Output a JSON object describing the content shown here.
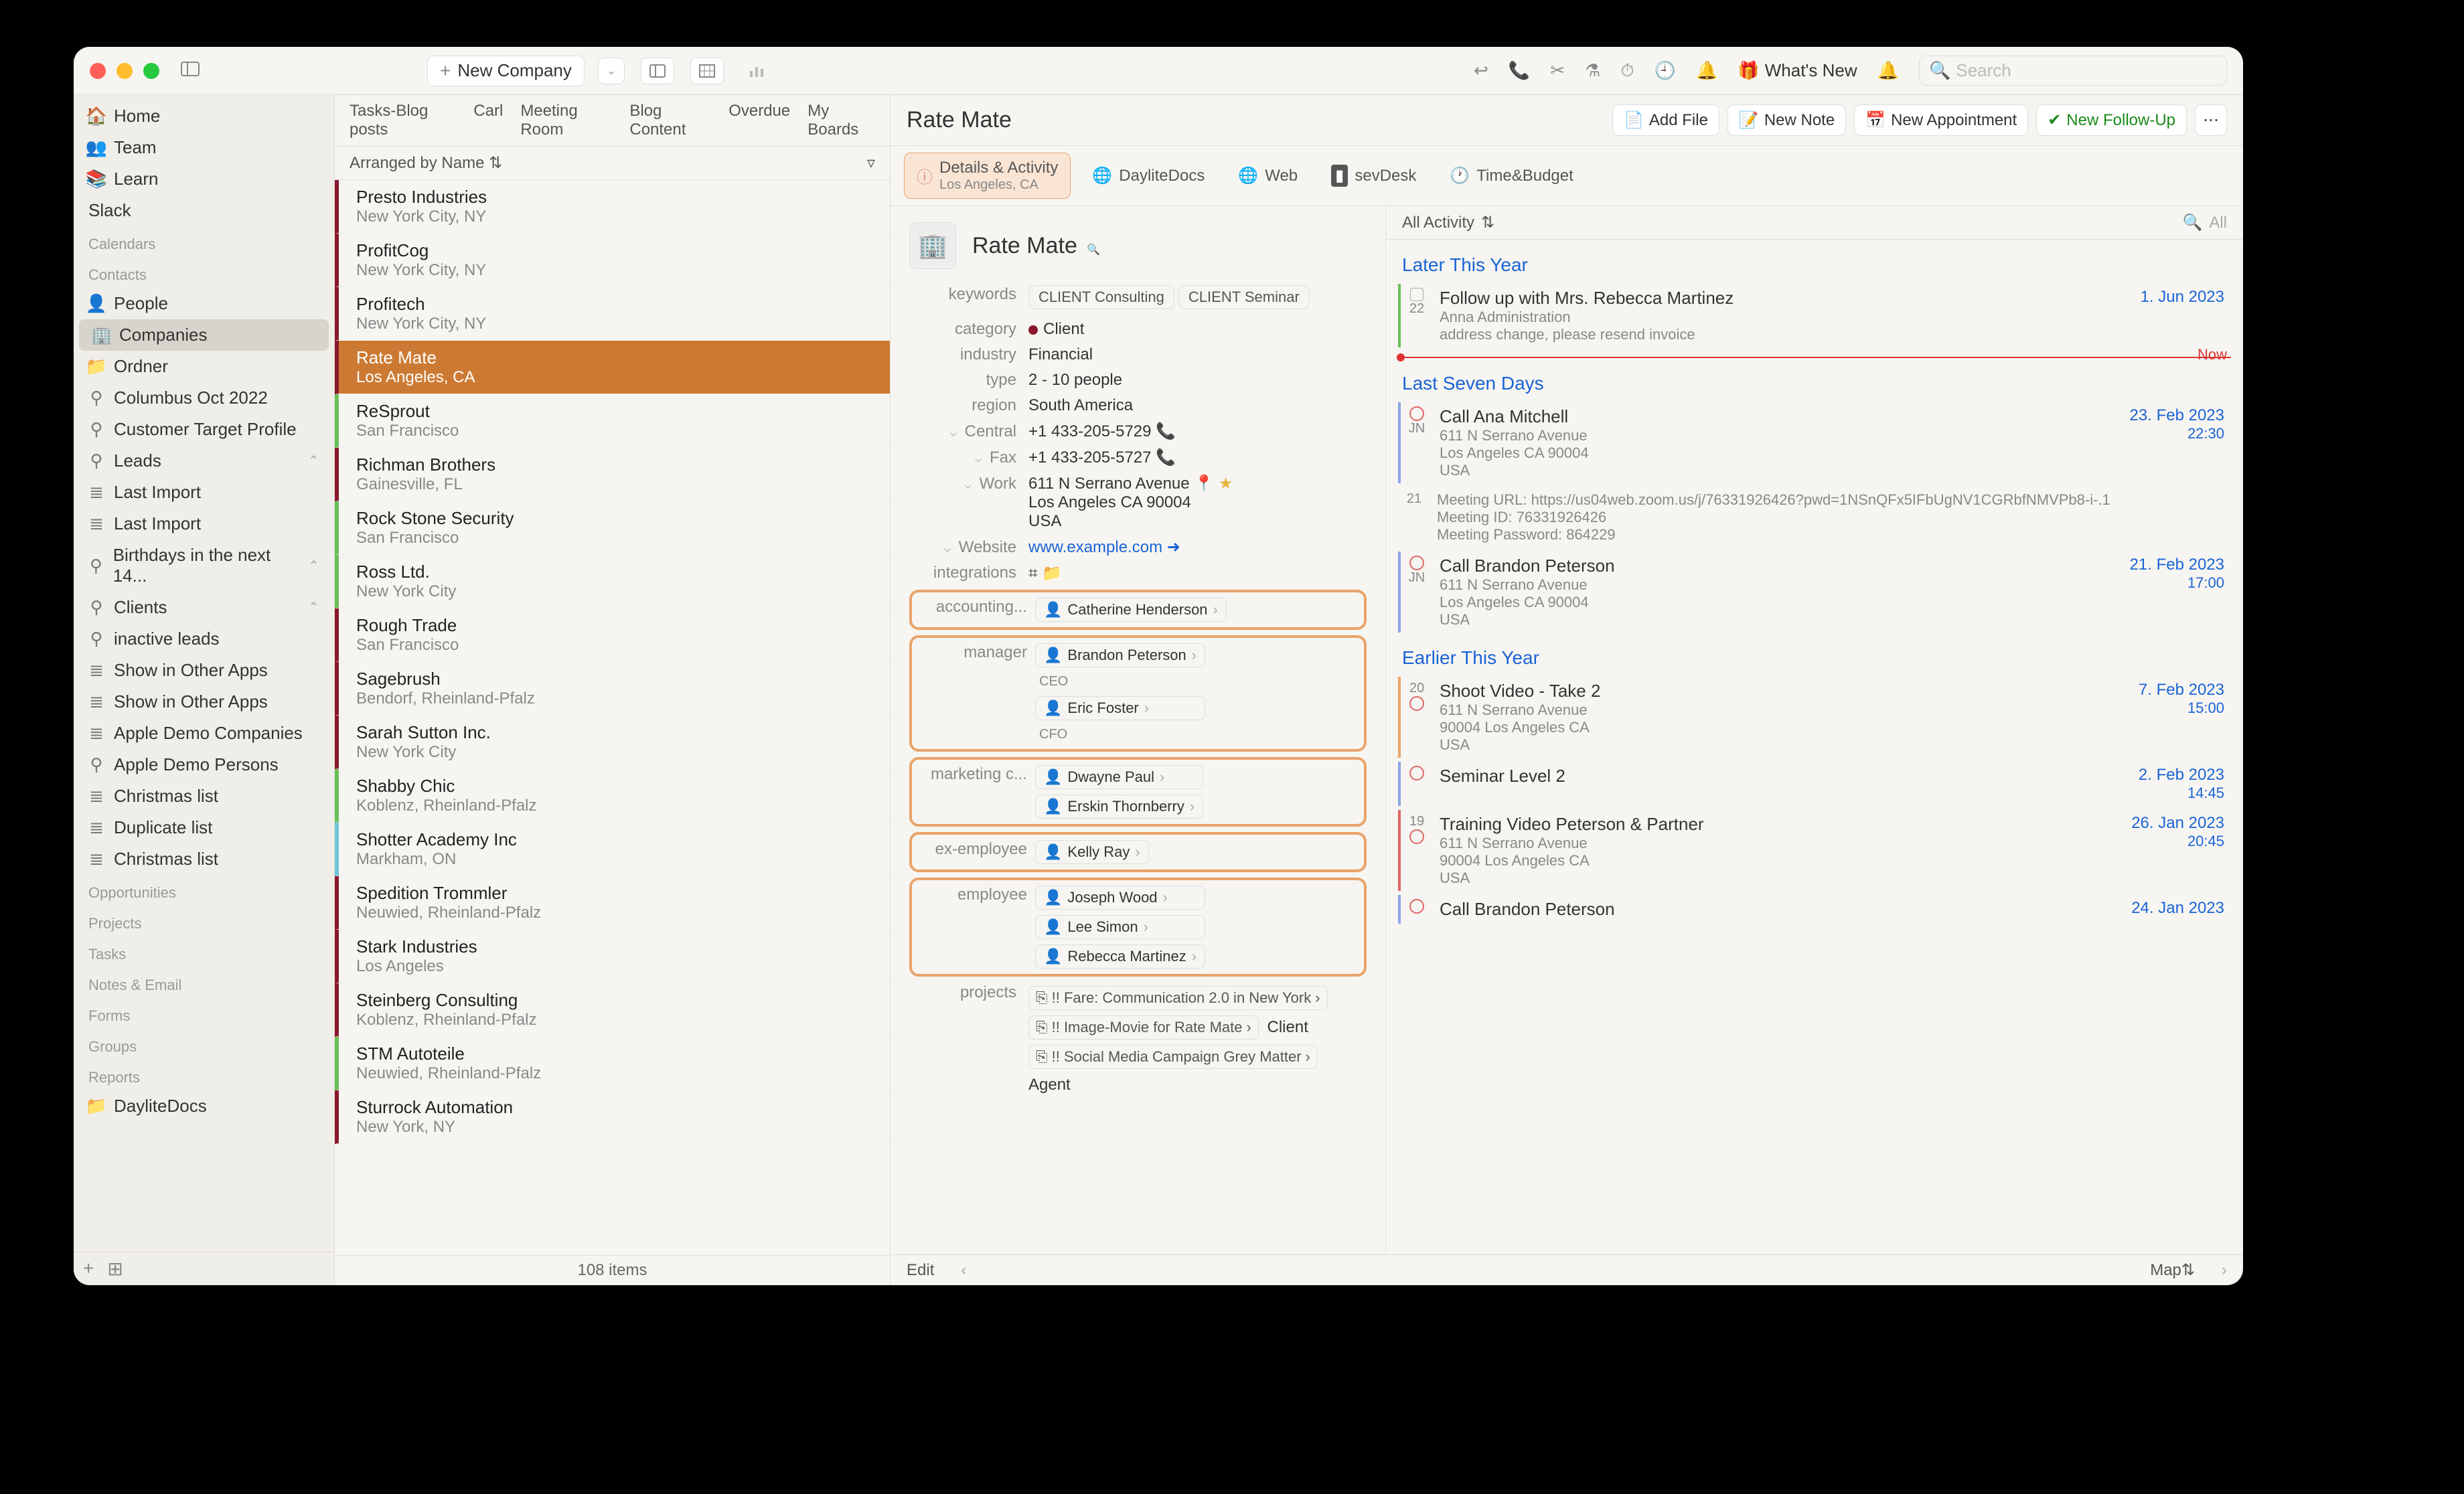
{
  "toolbar": {
    "new_company": "New Company",
    "whats_new": "What's New",
    "search_placeholder": "Search"
  },
  "sidebar": {
    "home": "Home",
    "team": "Team",
    "learn": "Learn",
    "slack": "Slack",
    "calendars_head": "Calendars",
    "contacts_head": "Contacts",
    "people": "People",
    "companies": "Companies",
    "ordner": "Ordner",
    "columbus": "Columbus Oct 2022",
    "ctp": "Customer Target Profile",
    "leads": "Leads",
    "lastimport1": "Last Import",
    "lastimport2": "Last Import",
    "birthdays": "Birthdays in the next 14...",
    "clients": "Clients",
    "inactive": "inactive leads",
    "showother1": "Show in Other Apps",
    "showother2": "Show in Other Apps",
    "applecomp": "Apple Demo Companies",
    "applepers": "Apple Demo Persons",
    "xmas1": "Christmas list",
    "dup": "Duplicate list",
    "xmas2": "Christmas list",
    "opportunities_head": "Opportunities",
    "projects_head": "Projects",
    "tasks_head": "Tasks",
    "notes_head": "Notes & Email",
    "forms_head": "Forms",
    "groups_head": "Groups",
    "reports_head": "Reports",
    "daylitedocs": "DayliteDocs"
  },
  "tabs": [
    "Tasks-Blog posts",
    "Carl",
    "Meeting Room",
    "Blog Content",
    "Overdue",
    "My Boards"
  ],
  "arranged": "Arranged by Name",
  "companies": [
    {
      "t": "Presto Industries",
      "s": "New York City, NY",
      "c": "#8a182e"
    },
    {
      "t": "ProfitCog",
      "s": "New York City, NY",
      "c": "#8a182e"
    },
    {
      "t": "Profitech",
      "s": "New York City, NY",
      "c": "#8a182e"
    },
    {
      "t": "Rate Mate",
      "s": "Los Angeles, CA",
      "c": "#8a182e",
      "sel": true
    },
    {
      "t": "ReSprout",
      "s": "San Francisco",
      "c": "#6bbf59"
    },
    {
      "t": "Richman Brothers",
      "s": "Gainesville, FL",
      "c": "#8a182e"
    },
    {
      "t": "Rock Stone Security",
      "s": "San Francisco",
      "c": "#6bbf59"
    },
    {
      "t": "Ross Ltd.",
      "s": "New York City",
      "c": "#6bbf59"
    },
    {
      "t": "Rough Trade",
      "s": "San Francisco",
      "c": "#8a182e"
    },
    {
      "t": "Sagebrush",
      "s": "Bendorf, Rheinland-Pfalz",
      "c": "#8a182e"
    },
    {
      "t": "Sarah Sutton Inc.",
      "s": "New York City",
      "c": "#8a182e"
    },
    {
      "t": "Shabby Chic",
      "s": "Koblenz, Rheinland-Pfalz",
      "c": "#6bbf59"
    },
    {
      "t": "Shotter Academy Inc",
      "s": "Markham, ON",
      "c": "#6ec6d9"
    },
    {
      "t": "Spedition Trommler",
      "s": "Neuwied, Rheinland-Pfalz",
      "c": "#8a182e"
    },
    {
      "t": "Stark Industries",
      "s": "Los Angeles",
      "c": "#8a182e"
    },
    {
      "t": "Steinberg Consulting",
      "s": "Koblenz, Rheinland-Pfalz",
      "c": "#8a182e"
    },
    {
      "t": "STM Autoteile",
      "s": "Neuwied, Rheinland-Pfalz",
      "c": "#6bbf59"
    },
    {
      "t": "Sturrock Automation",
      "s": "New York, NY",
      "c": "#8a182e"
    }
  ],
  "itemcount": "108 items",
  "detail": {
    "title": "Rate Mate",
    "add_file": "Add File",
    "new_note": "New Note",
    "new_appt": "New Appointment",
    "new_follow": "New Follow-Up",
    "tabs": {
      "details": "Details & Activity",
      "details_sub": "Los Angeles, CA",
      "docs": "DayliteDocs",
      "web": "Web",
      "sevdesk": "sevDesk",
      "timebudget": "Time&Budget"
    },
    "company_name": "Rate Mate",
    "keywords_k": "keywords",
    "kw1": "CLIENT Consulting",
    "kw2": "CLIENT Seminar",
    "category_k": "category",
    "category_v": "Client",
    "industry_k": "industry",
    "industry_v": "Financial",
    "type_k": "type",
    "type_v": "2 - 10 people",
    "region_k": "region",
    "region_v": "South America",
    "central_k": "Central",
    "central_v": "+1 433-205-5729",
    "fax_k": "Fax",
    "fax_v": "+1 433-205-5727",
    "work_k": "Work",
    "addr1": "611 N Serrano Avenue",
    "addr2": "Los Angeles  CA  90004",
    "addr3": "USA",
    "website_k": "Website",
    "website_v": "www.example.com",
    "integrations_k": "integrations",
    "roles": [
      {
        "label": "accounting...",
        "people": [
          {
            "n": "Catherine Henderson"
          }
        ]
      },
      {
        "label": "manager",
        "people": [
          {
            "n": "Brandon Peterson",
            "sub": "CEO"
          },
          {
            "n": "Eric Foster",
            "sub": "CFO"
          }
        ]
      },
      {
        "label": "marketing c...",
        "people": [
          {
            "n": "Dwayne Paul"
          },
          {
            "n": "Erskin Thornberry"
          }
        ]
      },
      {
        "label": "ex-employee",
        "people": [
          {
            "n": "Kelly Ray"
          }
        ]
      },
      {
        "label": "employee",
        "people": [
          {
            "n": "Joseph Wood"
          },
          {
            "n": "Lee Simon"
          },
          {
            "n": "Rebecca Martinez"
          }
        ]
      }
    ],
    "projects_k": "projects",
    "projects": [
      "!! Fare: Communication 2.0 in New York",
      "!! Image-Movie for Rate Mate",
      "!! Social Media Campaign Grey Matter"
    ],
    "projrole1": "Client",
    "projrole2": "Agent",
    "edit": "Edit"
  },
  "activity": {
    "filter": "All Activity",
    "all": "All",
    "sec1": "Later This Year",
    "i1": {
      "t": "Follow up with Mrs. Rebecca Martinez",
      "s1": "Anna Administration",
      "s2": "address change, please resend invoice",
      "d": "1. Jun 2023"
    },
    "sec2": "Last Seven Days",
    "i2": {
      "t": "Call Ana Mitchell",
      "s1": "611 N Serrano Avenue",
      "s2": "Los Angeles CA 90004",
      "s3": "USA",
      "d": "23. Feb 2023",
      "tm": "22:30"
    },
    "i2b": {
      "l1": "Meeting URL: https://us04web.zoom.us/j/76331926426?pwd=1NSnQFx5IFbUgNV1CGRbfNMVPb8-i-.1",
      "l2": "Meeting ID: 76331926426",
      "l3": "Meeting Password: 864229"
    },
    "i3": {
      "t": "Call Brandon Peterson",
      "s1": "611 N Serrano Avenue",
      "s2": "Los Angeles CA 90004",
      "s3": "USA",
      "d": "21. Feb 2023",
      "tm": "17:00"
    },
    "sec3": "Earlier This Year",
    "i4": {
      "t": "Shoot Video - Take 2",
      "s1": "611 N Serrano Avenue",
      "s2": "90004 Los Angeles CA",
      "s3": "USA",
      "d": "7. Feb 2023",
      "tm": "15:00"
    },
    "i5": {
      "t": "Seminar Level 2",
      "d": "2. Feb 2023",
      "tm": "14:45"
    },
    "i6": {
      "t": "Training Video Peterson & Partner",
      "s1": "611 N Serrano Avenue",
      "s2": "90004 Los Angeles CA",
      "s3": "USA",
      "d": "26. Jan 2023",
      "tm": "20:45"
    },
    "i7": {
      "t": "Call Brandon Peterson",
      "d": "24. Jan 2023"
    },
    "g22": "22",
    "gJN1": "JN",
    "g21": "21",
    "gJN2": "JN",
    "g20": "20",
    "g19": "19",
    "map": "Map"
  }
}
